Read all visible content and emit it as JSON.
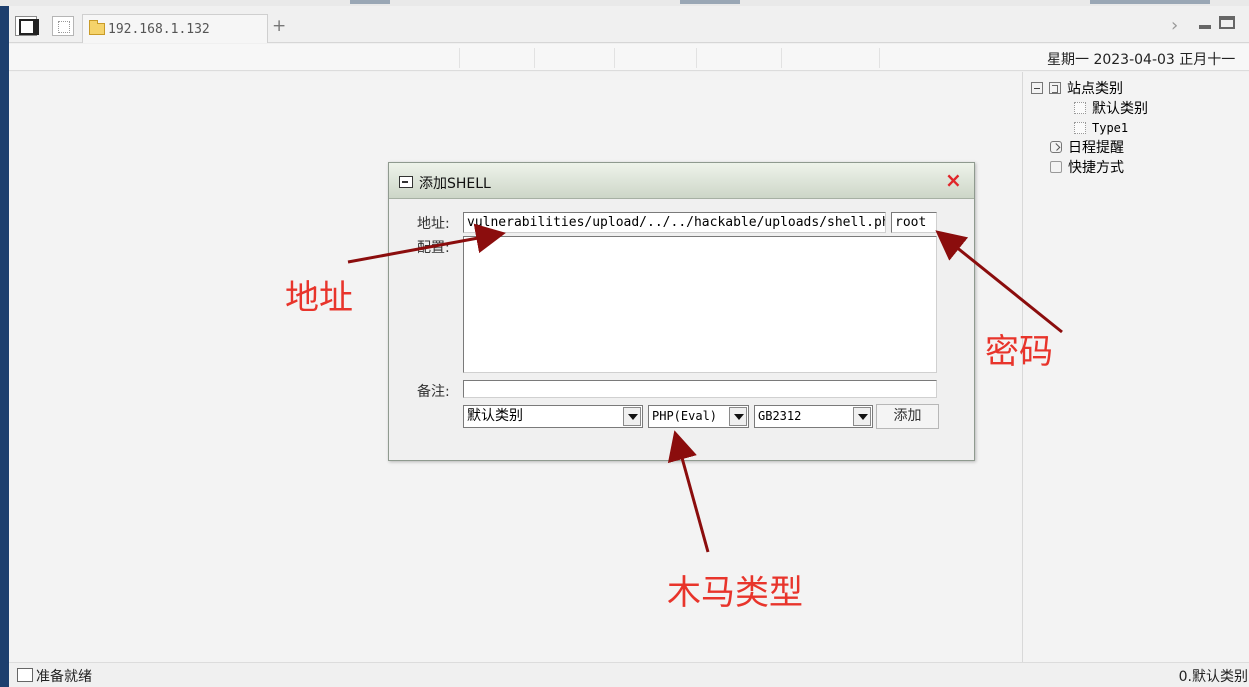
{
  "tabs": {
    "address_tab_label": "192.168.1.132",
    "add_tab_symbol": "+"
  },
  "header": {
    "date": "星期一 2023-04-03 正月十一"
  },
  "tree": {
    "root": "站点类别",
    "children": [
      "默认类别",
      "Type1"
    ],
    "schedule": "日程提醒",
    "shortcuts": "快捷方式"
  },
  "dialog": {
    "title": "添加SHELL",
    "close_symbol": "×",
    "address_label": "地址:",
    "address_value": "vulnerabilities/upload/../../hackable/uploads/shell.php",
    "password_value": "root",
    "config_label": "配置:",
    "note_label": "备注:",
    "note_value": "",
    "category_selected": "默认类别",
    "shell_type_selected": "PHP(Eval)",
    "encoding_selected": "GB2312",
    "add_button": "添加"
  },
  "annotations": {
    "address": "地址",
    "password": "密码",
    "shell_type": "木马类型",
    "color": "#e8342b",
    "arrow_color": "#8b0d0d"
  },
  "status": {
    "left": "准备就绪",
    "right": "0.默认类别"
  },
  "icons": [
    "folder-icon",
    "minimize-icon",
    "maximize-icon",
    "chevron-right-icon",
    "close-icon",
    "collapse-icon",
    "category-icon",
    "clock-icon",
    "hand-icon"
  ]
}
